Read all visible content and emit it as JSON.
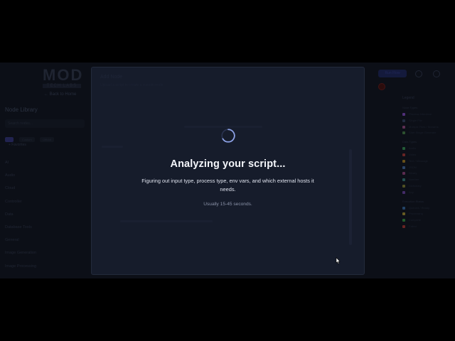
{
  "app": {
    "logo_text": "MOD",
    "logo_subtext": "TECH LABS",
    "back_label": "← Back to Home"
  },
  "sidebar": {
    "title": "Node Library",
    "search_placeholder": "Search nodes...",
    "chips": [
      "All",
      "Custom",
      "Official"
    ],
    "favorites_label": "+ Favorites",
    "categories": [
      "AI",
      "Audio",
      "Cloud",
      "Controller",
      "Data",
      "Database Tools",
      "General",
      "Image Generation",
      "Image Processing"
    ]
  },
  "topbar": {
    "primary_button_label": "Run Flow"
  },
  "legend": {
    "title": "Legend",
    "groups": [
      {
        "title": "Node Types",
        "items": [
          {
            "label": "Process Inference",
            "color": "#6b3fa0"
          },
          {
            "label": "Single File",
            "color": "#2c3a55"
          },
          {
            "label": "Multiple Files / Streams",
            "color": "#7b3f6e"
          },
          {
            "label": "Start Single Generate",
            "color": "#3d6b3f"
          }
        ]
      },
      {
        "title": "Data Types",
        "items": [
          {
            "label": "Audio",
            "color": "#2f7a4a"
          },
          {
            "label": "Video",
            "color": "#8a3030"
          },
          {
            "label": "Text / Message",
            "color": "#8a6a20"
          },
          {
            "label": "JSON",
            "color": "#3a5a8a"
          },
          {
            "label": "Binary",
            "color": "#7a3a6a"
          },
          {
            "label": "Number",
            "color": "#2f6a6a"
          },
          {
            "label": "Dictionary",
            "color": "#6a6a2f"
          },
          {
            "label": "Any",
            "color": "#5a3a8a"
          }
        ]
      },
      {
        "title": "Execution Status",
        "items": [
          {
            "label": "Queued / Ready",
            "color": "#2f5a8a"
          },
          {
            "label": "Processing",
            "color": "#8a7a2f"
          },
          {
            "label": "Complete",
            "color": "#2f7a3a"
          },
          {
            "label": "Failed",
            "color": "#8a2f2f"
          }
        ]
      }
    ]
  },
  "modal": {
    "background_title": "Add Node",
    "background_subtitle": "Upload a script to create a custom node",
    "status_title": "Analyzing your script...",
    "status_description": "Figuring out input type, process type, env vars, and which external hosts it needs.",
    "status_note": "Usually 15-45 seconds.",
    "spinner_color": "#8ea3e8"
  },
  "colors": {
    "backdrop": "#000000",
    "app_background": "#10141f",
    "modal_background": "#161c2b",
    "accent": "#2c2f6b"
  }
}
